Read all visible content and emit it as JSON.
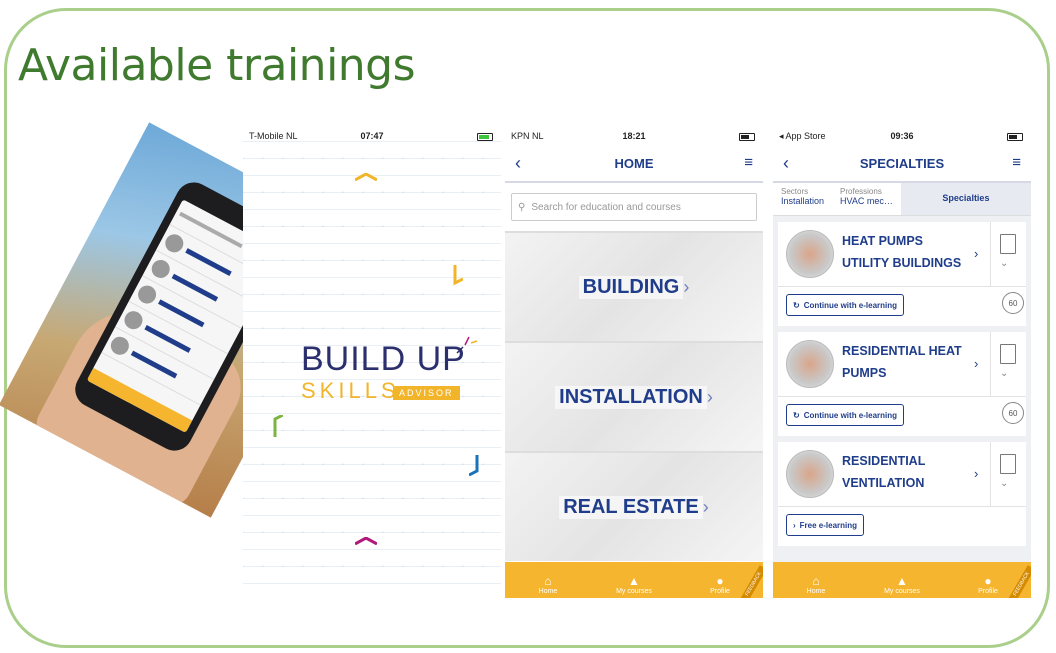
{
  "slide": {
    "title": "Available trainings"
  },
  "splash": {
    "status": {
      "carrier": "T-Mobile NL",
      "time": "07:47"
    },
    "logo_main": "BUILD UP",
    "logo_sub": "SKILLS",
    "logo_badge": "ADVISOR"
  },
  "home": {
    "status": {
      "carrier": "KPN NL",
      "time": "18:21"
    },
    "nav": {
      "back": "‹",
      "title": "HOME",
      "menu": "≡"
    },
    "search": {
      "placeholder": "Search for education and courses"
    },
    "categories": [
      {
        "label": "BUILDING"
      },
      {
        "label": "INSTALLATION"
      },
      {
        "label": "REAL ESTATE"
      }
    ],
    "tabs": [
      {
        "label": "Home",
        "icon": "home-icon"
      },
      {
        "label": "My courses",
        "icon": "graduation-cap-icon"
      },
      {
        "label": "Profile",
        "icon": "person-icon"
      }
    ],
    "feedback": "FEEDBACK",
    "accent": "#f5b52e",
    "brand": "#1f3d8a"
  },
  "specialties": {
    "status": {
      "carrier": "◂ App Store",
      "time": "09:36"
    },
    "nav": {
      "back": "‹",
      "title": "SPECIALTIES",
      "menu": "≡"
    },
    "breadcrumbs": [
      {
        "caption": "Sectors",
        "value": "Installation"
      },
      {
        "caption": "Professions",
        "value": "HVAC mec…"
      },
      {
        "caption": "",
        "value": "Specialties"
      }
    ],
    "cards": [
      {
        "title": "HEAT PUMPS UTILITY BUILDINGS",
        "button": "Continue with e-learning",
        "count": "60"
      },
      {
        "title": "RESIDENTIAL HEAT PUMPS",
        "button": "Continue with e-learning",
        "count": "60"
      },
      {
        "title": "RESIDENTIAL VENTILATION",
        "button": "Free e-learning",
        "count": ""
      }
    ],
    "tabs": [
      {
        "label": "Home"
      },
      {
        "label": "My courses"
      },
      {
        "label": "Profile"
      }
    ],
    "feedback": "FEEDBACK"
  }
}
